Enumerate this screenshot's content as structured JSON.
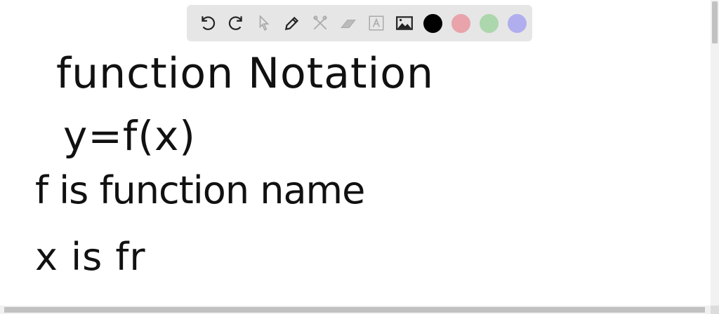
{
  "toolbar": {
    "tools": [
      "undo-icon",
      "redo-icon",
      "select-icon",
      "pen-icon",
      "tools-icon",
      "eraser-icon",
      "text-icon",
      "image-icon"
    ],
    "colors": [
      "#000000",
      "#e8a3ab",
      "#acd6ac",
      "#b0aeee"
    ]
  },
  "canvas": {
    "lines": [
      "function Notation",
      "y=f(x)",
      "f is function name",
      "x is fr"
    ]
  }
}
